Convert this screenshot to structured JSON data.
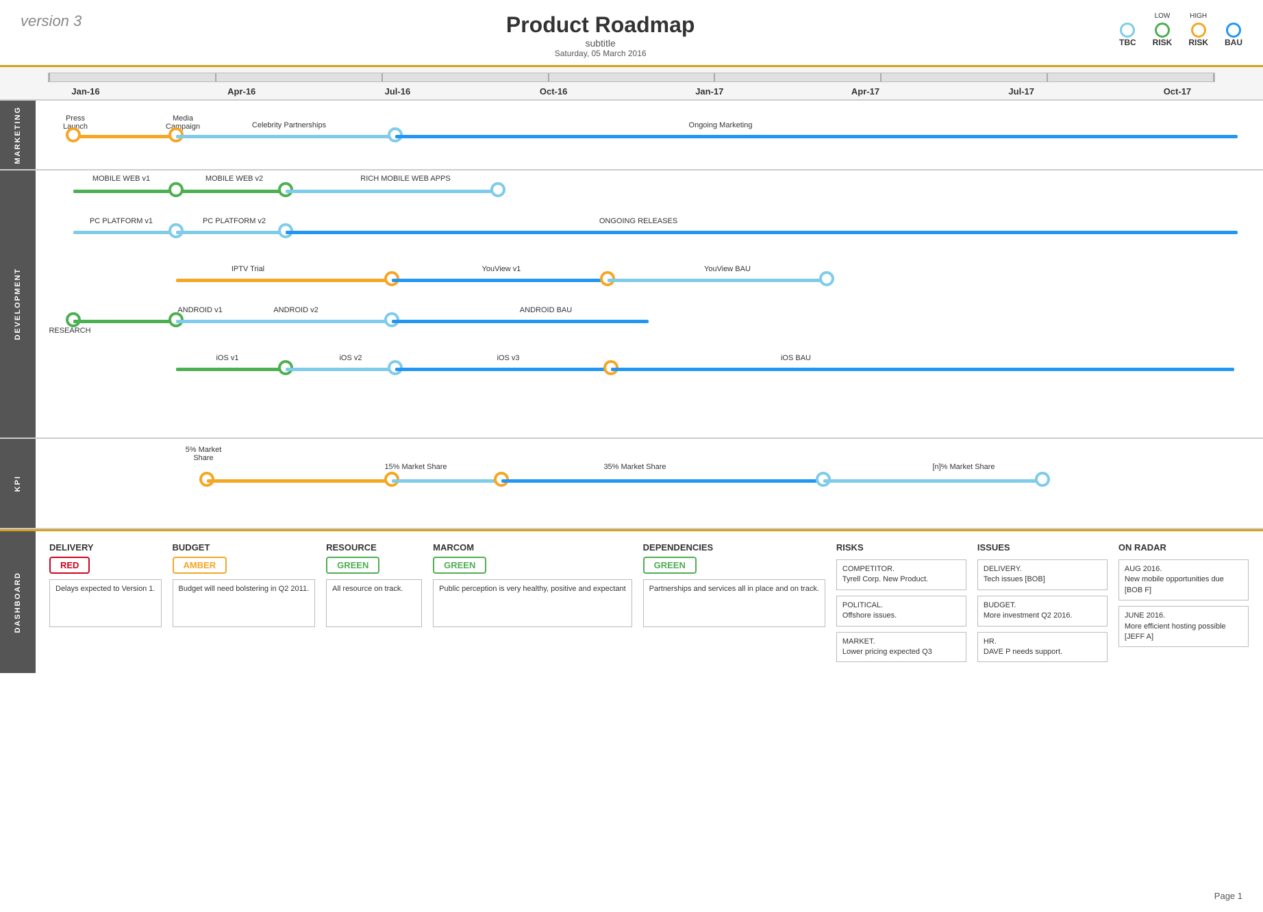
{
  "header": {
    "version": "version 3",
    "title": "Product Roadmap",
    "subtitle": "subtitle",
    "date": "Saturday, 05 March 2016",
    "legend": [
      {
        "label": "TBC",
        "top_label": "",
        "color_border": "#7ecbea"
      },
      {
        "label": "LOW\nRISK",
        "top_label": "LOW",
        "label2": "RISK",
        "color_border": "#4CAF50"
      },
      {
        "label": "HIGH\nRISK",
        "top_label": "HIGH",
        "label2": "RISK",
        "color_border": "#f5a623"
      },
      {
        "label": "BAU",
        "top_label": "",
        "color_border": "#2196F3"
      }
    ]
  },
  "timeline": {
    "labels": [
      "Jan-16",
      "Apr-16",
      "Jul-16",
      "Oct-16",
      "Jan-17",
      "Apr-17",
      "Jul-17",
      "Oct-17"
    ]
  },
  "sections": {
    "marketing": {
      "label": "MARKETING",
      "rows": [
        {
          "label": "Press\nLaunch",
          "label2": "Media\nCampaign",
          "label3": "Celebrity Partnerships",
          "label4": "Ongoing Marketing"
        }
      ]
    },
    "development": {
      "label": "DEVELOPMENT"
    },
    "kpi": {
      "label": "KPI"
    }
  },
  "dashboard": {
    "label": "DASHBOARD",
    "cards": [
      {
        "title": "DELIVERY",
        "status": "RED",
        "status_class": "status-red",
        "note": "Delays expected to Version 1."
      },
      {
        "title": "BUDGET",
        "status": "AMBER",
        "status_class": "status-amber",
        "note": "Budget will need bolstering in Q2 2011."
      },
      {
        "title": "RESOURCE",
        "status": "GREEN",
        "status_class": "status-green",
        "note": "All resource on track."
      },
      {
        "title": "MARCOM",
        "status": "GREEN",
        "status_class": "status-green",
        "note": "Public perception is very healthy, positive and expectant"
      },
      {
        "title": "DEPENDENCIES",
        "status": "GREEN",
        "status_class": "status-green",
        "note": "Partnerships and services all in place and on track."
      }
    ],
    "risks": {
      "title": "RISKS",
      "items": [
        "COMPETITOR.\nTyrell Corp. New Product.",
        "POLITICAL.\nOffshore issues.",
        "MARKET.\nLower pricing expected Q3"
      ]
    },
    "issues": {
      "title": "ISSUES",
      "items": [
        "DELIVERY.\nTech issues [BOB]",
        "BUDGET.\nMore investment Q2 2016.",
        "HR.\nDAVE P needs support."
      ]
    },
    "on_radar": {
      "title": "ON RADAR",
      "items": [
        "AUG 2016.\nNew mobile opportunities due\n[BOB F]",
        "JUNE 2016.\nMore efficient hosting possible\n[JEFF A]"
      ]
    }
  },
  "page": "Page 1"
}
